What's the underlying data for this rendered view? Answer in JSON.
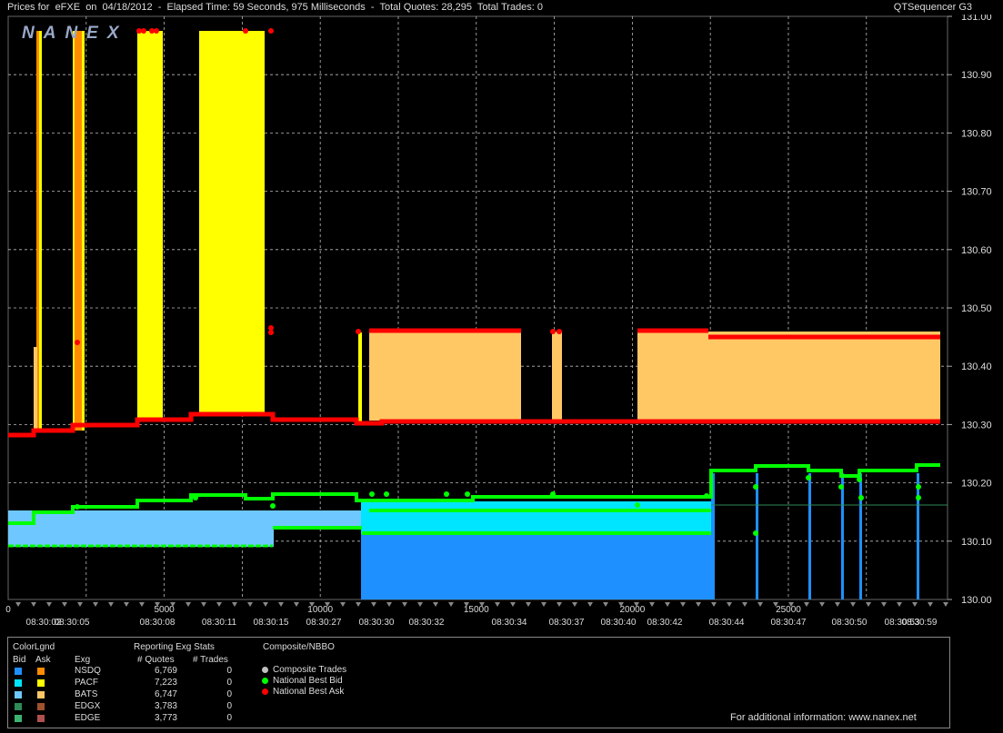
{
  "header": {
    "title": "Prices for  eFXE  on  04/18/2012  -  Elapsed Time: 59 Seconds, 975 Milliseconds  -  Total Quotes: 28,295  Total Trades: 0",
    "app_name": "QTSequencer G3",
    "watermark": "NANEX"
  },
  "chart_data": {
    "type": "area",
    "y_ticks": [
      "131.00",
      "130.90",
      "130.80",
      "130.70",
      "130.60",
      "130.50",
      "130.40",
      "130.30",
      "130.20",
      "130.10",
      "130.00"
    ],
    "ylim": [
      130.0,
      131.0
    ],
    "x_seq_ticks": [
      "0",
      "5000",
      "10000",
      "15000",
      "20000",
      "25000"
    ],
    "x_time_labels": [
      "08:30:02",
      "08:30:05",
      "08:30:08",
      "08:30:11",
      "08:30:15",
      "08:30:27",
      "08:30:30",
      "08:30:32",
      "08:30:34",
      "08:30:37",
      "08:30:40",
      "08:30:42",
      "08:30:44",
      "08:30:47",
      "08:30:50",
      "08:30:53",
      "08:30:59"
    ],
    "series": [
      {
        "name": "National Best Bid",
        "color": "#00ff00"
      },
      {
        "name": "National Best Ask",
        "color": "#ff0000"
      }
    ]
  },
  "legend": {
    "col_title": "ColorLgnd",
    "bid_label": "Bid",
    "ask_label": "Ask",
    "exch_header": "Exg",
    "stats_title": "Reporting Exg Stats",
    "quotes_header": "# Quotes",
    "trades_header": "# Trades",
    "composite_title": "Composite/NBBO",
    "exchanges": [
      {
        "name": "NSDQ",
        "quotes": "6,769",
        "trades": "0",
        "bid_color": "#1e90ff",
        "ask_color": "#ff8c00"
      },
      {
        "name": "PACF",
        "quotes": "7,223",
        "trades": "0",
        "bid_color": "#00e5ff",
        "ask_color": "#ffff00"
      },
      {
        "name": "BATS",
        "quotes": "6,747",
        "trades": "0",
        "bid_color": "#6ec8ff",
        "ask_color": "#ffc864"
      },
      {
        "name": "EDGX",
        "quotes": "3,783",
        "trades": "0",
        "bid_color": "#2e8b57",
        "ask_color": "#a0522d"
      },
      {
        "name": "EDGE",
        "quotes": "3,773",
        "trades": "0",
        "bid_color": "#3cb371",
        "ask_color": "#b05050"
      }
    ],
    "composite": [
      {
        "label": "Composite Trades",
        "color": "#c0c0c0"
      },
      {
        "label": "National Best Bid",
        "color": "#00ff00"
      },
      {
        "label": "National Best Ask",
        "color": "#ff0000"
      }
    ],
    "footer": "For additional information: www.nanex.net"
  }
}
